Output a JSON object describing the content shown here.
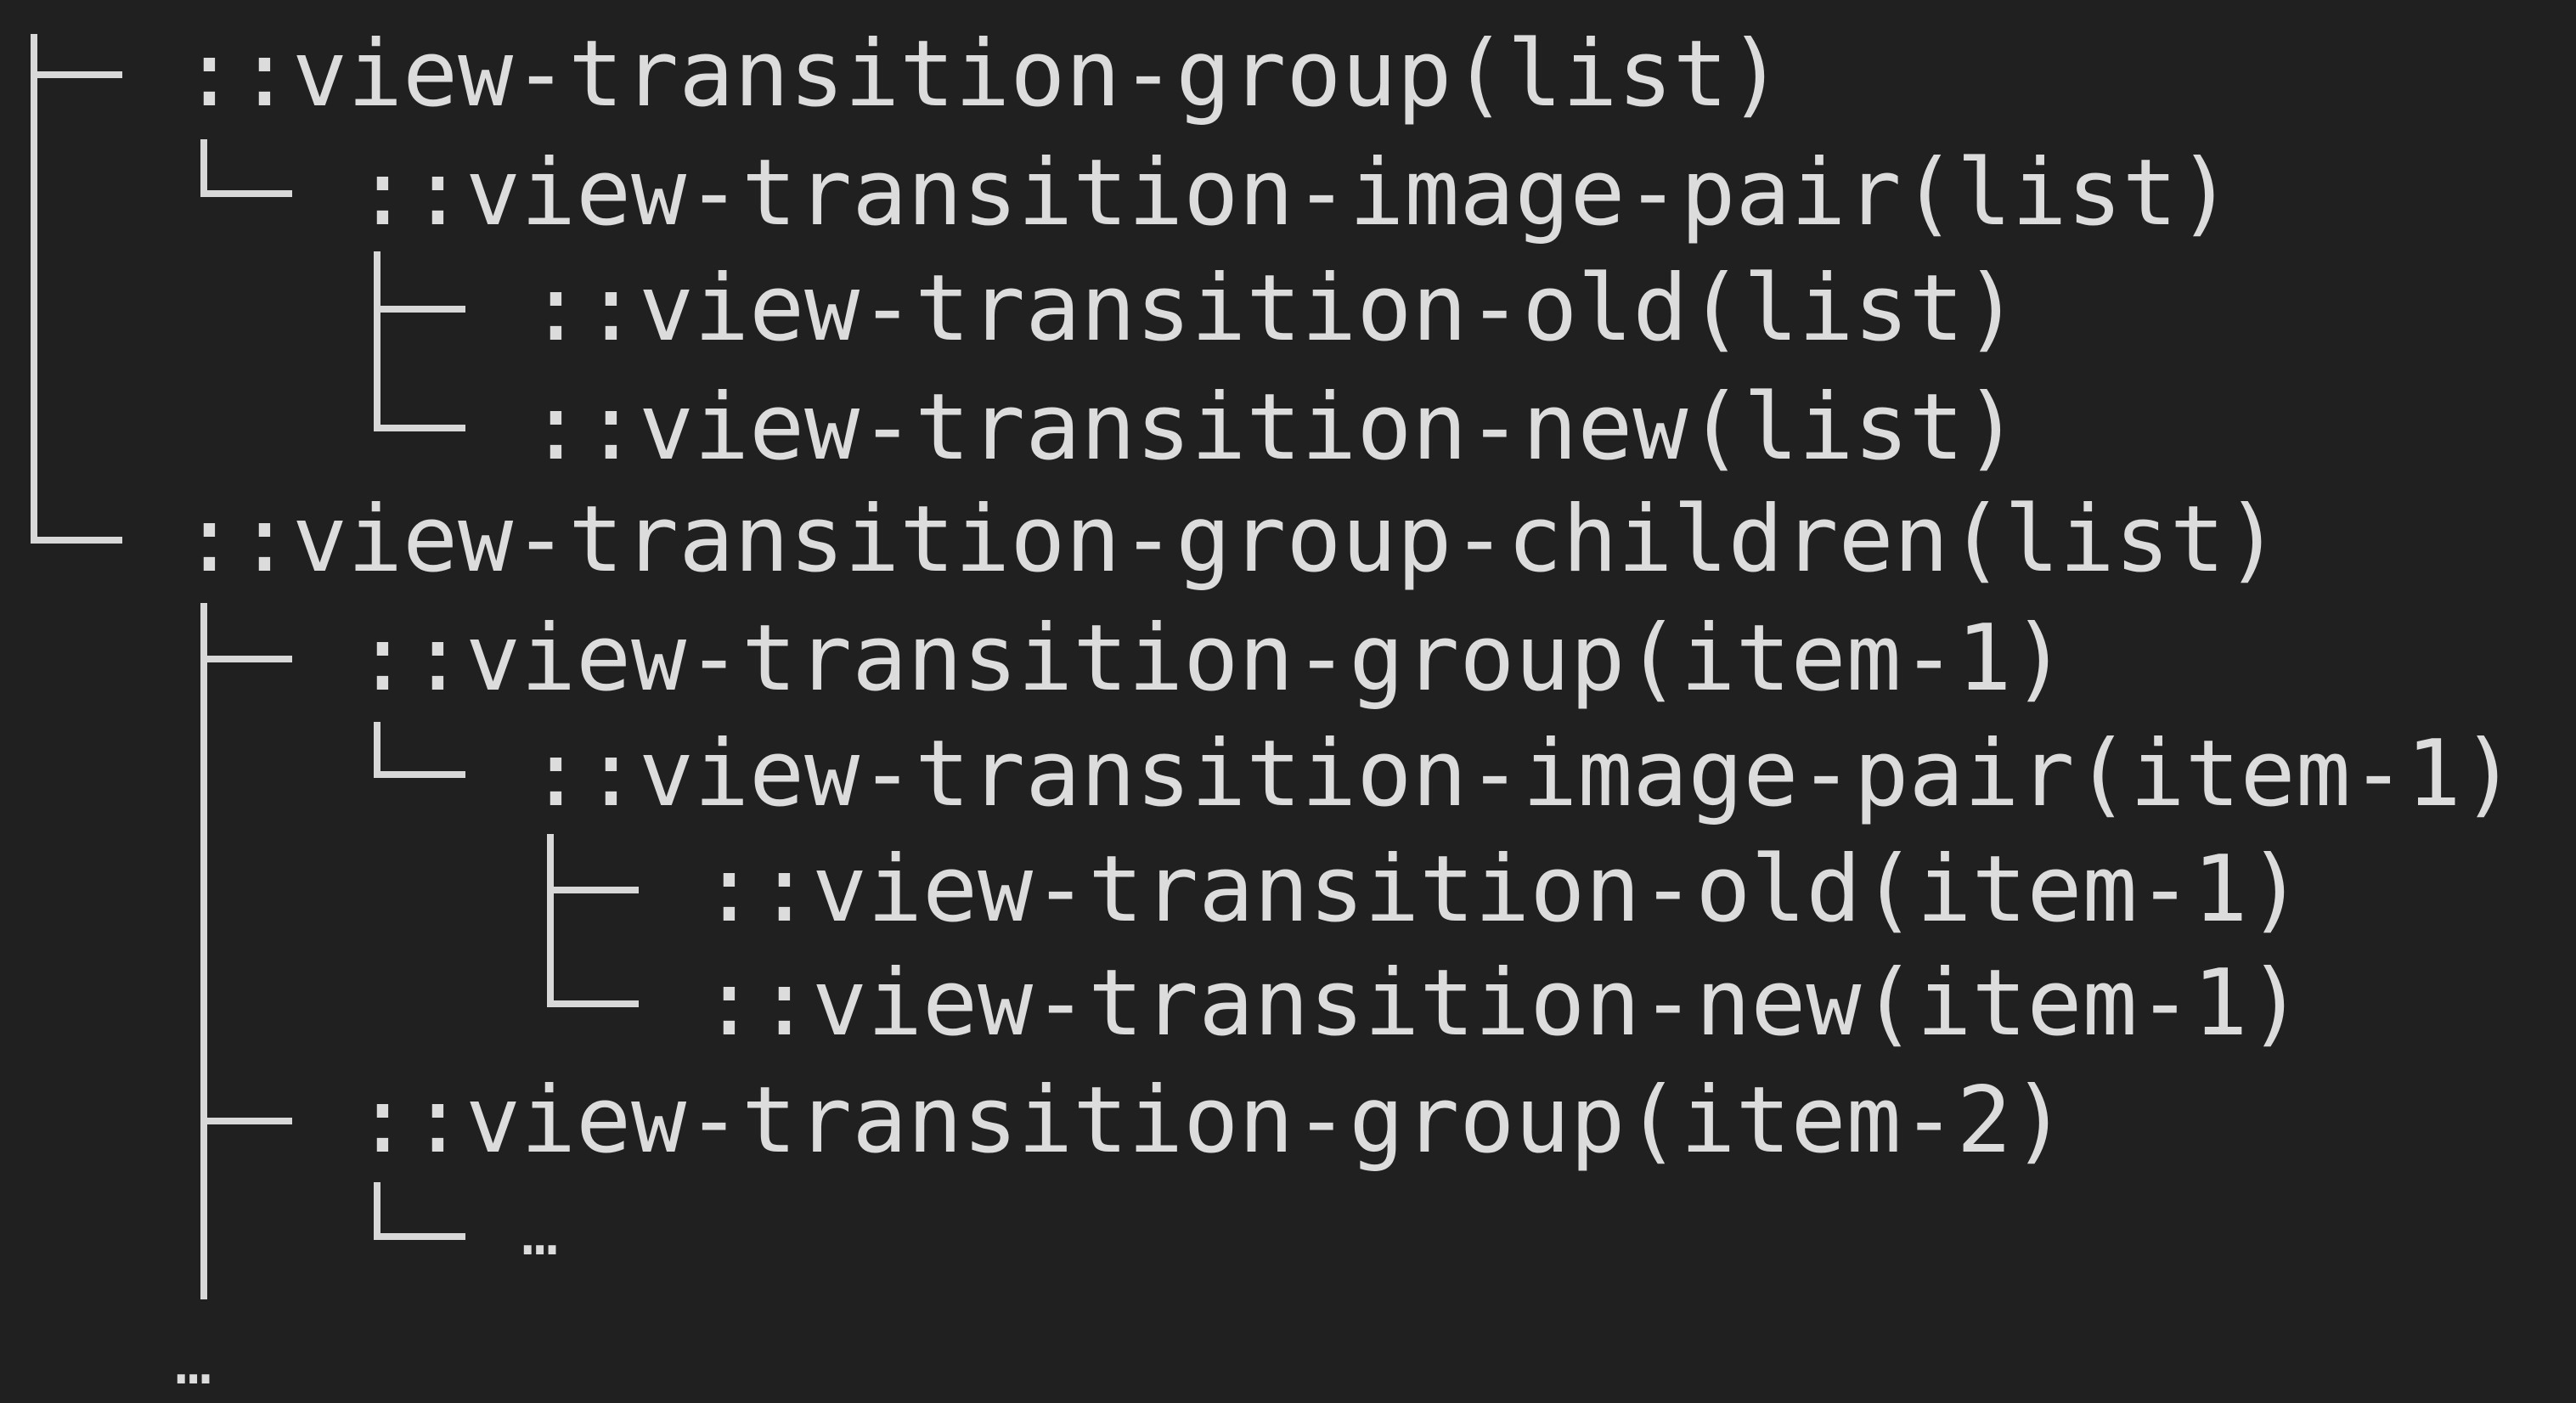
{
  "theme": {
    "background": "#202020",
    "text": "#dcdcdc",
    "connector": "#d8d8d8"
  },
  "tree": {
    "group_list": "::view-transition-group(list)",
    "image_pair_list": "::view-transition-image-pair(list)",
    "old_list": "::view-transition-old(list)",
    "new_list": "::view-transition-new(list)",
    "group_children_list": "::view-transition-group-children(list)",
    "group_item_1": "::view-transition-group(item-1)",
    "image_pair_item_1": "::view-transition-image-pair(item-1)",
    "old_item_1": "::view-transition-old(item-1)",
    "new_item_1": "::view-transition-new(item-1)",
    "group_item_2": "::view-transition-group(item-2)",
    "item_2_more": "…",
    "root_more": "…"
  }
}
